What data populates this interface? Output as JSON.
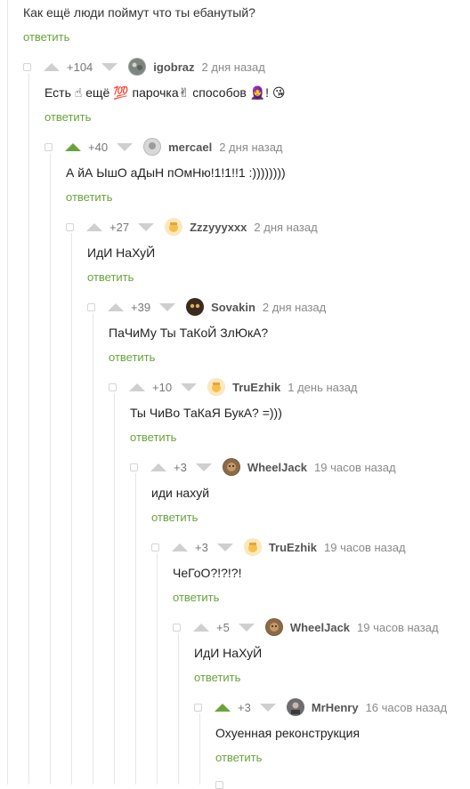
{
  "top_comment": {
    "text": "Как ещё люди поймут что ты ебанутый?",
    "reply_label": "ответить"
  },
  "comments": [
    {
      "rating": "+104",
      "author": "igobraz",
      "time": "2 дня назад",
      "text": "Есть ☝ ещё 💯 парочка✌ способов 🧕! 😘",
      "reply": "ответить",
      "upvoted": false
    },
    {
      "rating": "+40",
      "author": "mercael",
      "time": "2 дня назад",
      "text": "А йА ЫшО аДыН пОмНю!1!1!!1 :))))))))",
      "reply": "ответить",
      "upvoted": true
    },
    {
      "rating": "+27",
      "author": "Zzzyyyxxx",
      "time": "2 дня назад",
      "text": "ИдИ НаХуЙ",
      "reply": "ответить",
      "upvoted": false
    },
    {
      "rating": "+39",
      "author": "Sovakin",
      "time": "2 дня назад",
      "text": "ПаЧиМу Ты ТаКоЙ ЗлЮкА?",
      "reply": "ответить",
      "upvoted": false
    },
    {
      "rating": "+10",
      "author": "TruEzhik",
      "time": "1 день назад",
      "text": "Ты ЧиВо ТаКаЯ БукА? =)))",
      "reply": "ответить",
      "upvoted": false
    },
    {
      "rating": "+3",
      "author": "WheelJack",
      "time": "19 часов назад",
      "text": "иди нахуй",
      "reply": "ответить",
      "upvoted": false
    },
    {
      "rating": "+3",
      "author": "TruEzhik",
      "time": "19 часов назад",
      "text": "ЧеГоО?!?!?!",
      "reply": "ответить",
      "upvoted": false
    },
    {
      "rating": "+5",
      "author": "WheelJack",
      "time": "19 часов назад",
      "text": "ИдИ НаХуЙ",
      "reply": "ответить",
      "upvoted": false
    },
    {
      "rating": "+3",
      "author": "MrHenry",
      "time": "16 часов назад",
      "text": "Охуенная реконструкция",
      "reply": "ответить",
      "upvoted": true
    }
  ],
  "colors": {
    "accent": "#6aa33b",
    "muted": "#8a8a8a",
    "line": "#e6e6e6"
  },
  "icons": [
    "collapse-icon",
    "upvote-icon",
    "downvote-icon",
    "avatar-icon"
  ]
}
